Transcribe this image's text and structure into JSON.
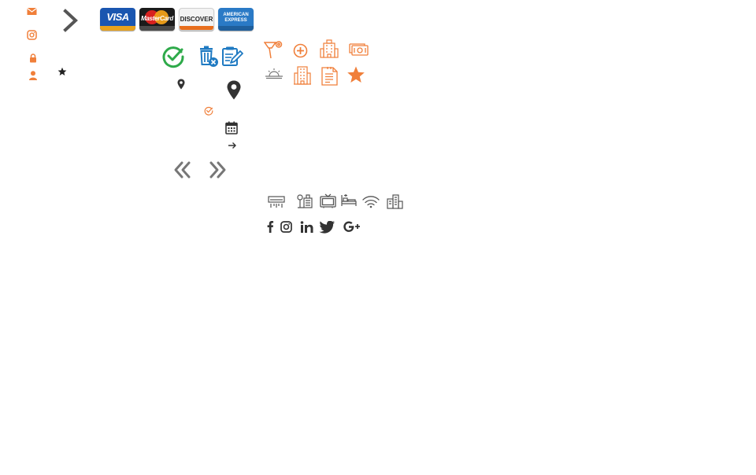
{
  "payment_cards": {
    "visa": "VISA",
    "mastercard": "MasterCard",
    "discover": "DISCOVER",
    "amex_line1": "AMERICAN",
    "amex_line2": "EXPRESS"
  },
  "colors": {
    "accent_orange": "#f07f3a",
    "dark_gray": "#3a3a3a",
    "green": "#2eaa4a",
    "blue": "#1f7ac2"
  },
  "icons": [
    "mail-icon",
    "instagram-icon",
    "lock-icon",
    "user-icon",
    "chevron-right-icon",
    "star-icon",
    "check-circle-icon",
    "trash-remove-icon",
    "edit-icon",
    "map-pin-icon",
    "calendar-icon",
    "arrow-right-icon",
    "double-chevron-left-icon",
    "double-chevron-right-icon",
    "hairdryer-icon",
    "plus-circle-icon",
    "hotel-icon",
    "money-icon",
    "sunrise-icon",
    "building-icon",
    "document-icon",
    "air-conditioner-icon",
    "garden-icon",
    "tv-icon",
    "bed-icon",
    "wifi-icon",
    "city-icon",
    "facebook-icon",
    "linkedin-icon",
    "twitter-icon",
    "google-plus-icon"
  ]
}
